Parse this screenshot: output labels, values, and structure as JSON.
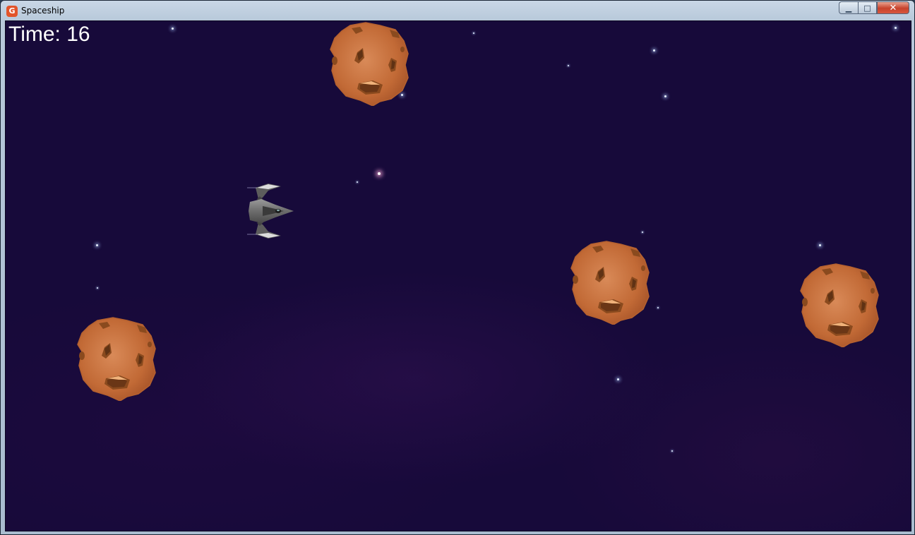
{
  "window": {
    "title": "Spaceship",
    "icon": "monogame-logo-icon",
    "controls": {
      "minimize": "minimize-icon",
      "maximize": "maximize-icon",
      "close": "close-icon"
    },
    "control_glyphs": {
      "minimize": "▁",
      "maximize": "□",
      "close": "✕"
    }
  },
  "hud": {
    "time_label": "Time: 16"
  },
  "colors": {
    "space": "#170a3a",
    "asteroid": "#c26a36",
    "asteroid_crater": "#8a4a1e",
    "ship": "#7a7a7a",
    "title_close": "#c7422b"
  },
  "entities": {
    "ship": "spaceship-icon",
    "asteroid": "asteroid-icon",
    "star": "star-icon"
  }
}
